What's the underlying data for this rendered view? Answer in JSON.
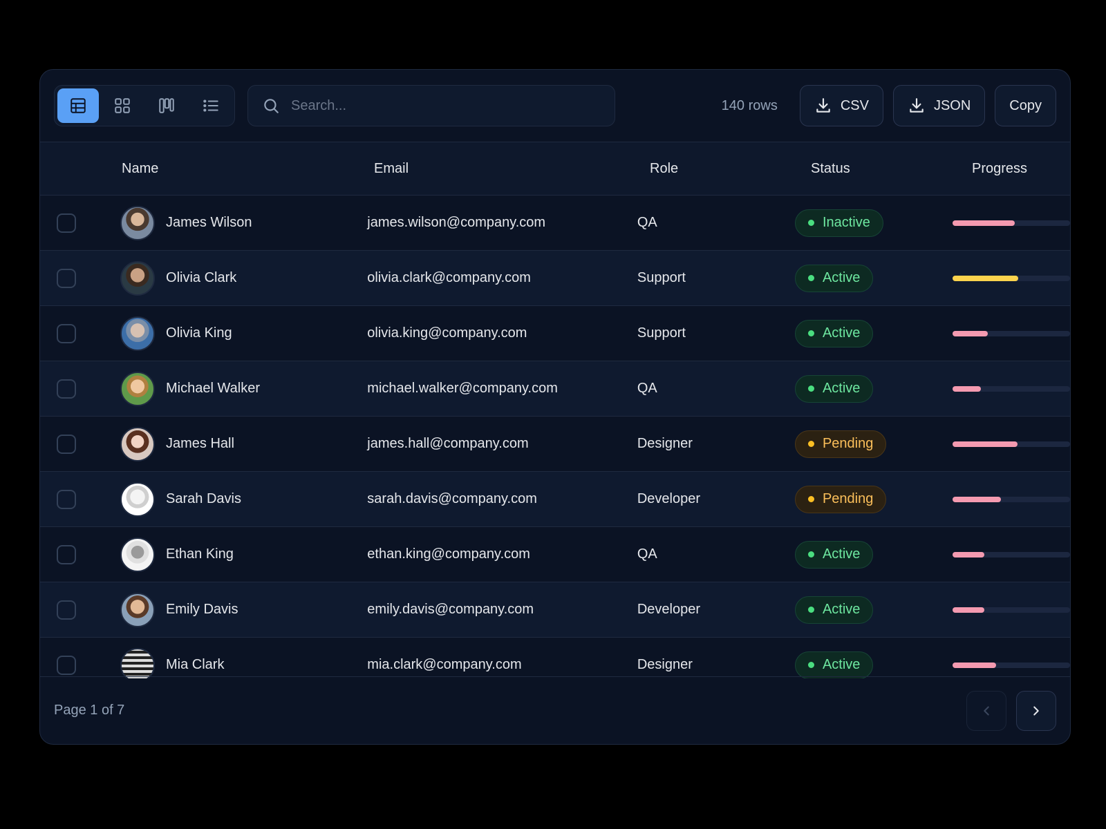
{
  "toolbar": {
    "views": [
      {
        "name": "table-view",
        "icon": "table-icon",
        "active": true
      },
      {
        "name": "grid-view",
        "icon": "grid-icon",
        "active": false
      },
      {
        "name": "board-view",
        "icon": "columns-icon",
        "active": false
      },
      {
        "name": "list-view",
        "icon": "list-icon",
        "active": false
      }
    ],
    "search_placeholder": "Search...",
    "row_count": "140 rows",
    "csv_label": "CSV",
    "json_label": "JSON",
    "copy_label": "Copy"
  },
  "table": {
    "columns": [
      "Name",
      "Email",
      "Role",
      "Status",
      "Progress"
    ],
    "rows": [
      {
        "name": "James Wilson",
        "email": "james.wilson@company.com",
        "role": "QA",
        "status": "Inactive",
        "status_tone": "green",
        "progress": 0.53,
        "progress_color": "#f49ab0"
      },
      {
        "name": "Olivia Clark",
        "email": "olivia.clark@company.com",
        "role": "Support",
        "status": "Active",
        "status_tone": "green",
        "progress": 0.56,
        "progress_color": "#fcd34d"
      },
      {
        "name": "Olivia King",
        "email": "olivia.king@company.com",
        "role": "Support",
        "status": "Active",
        "status_tone": "green",
        "progress": 0.3,
        "progress_color": "#f49ab0"
      },
      {
        "name": "Michael Walker",
        "email": "michael.walker@company.com",
        "role": "QA",
        "status": "Active",
        "status_tone": "green",
        "progress": 0.24,
        "progress_color": "#f49ab0"
      },
      {
        "name": "James Hall",
        "email": "james.hall@company.com",
        "role": "Designer",
        "status": "Pending",
        "status_tone": "amber",
        "progress": 0.55,
        "progress_color": "#f49ab0"
      },
      {
        "name": "Sarah Davis",
        "email": "sarah.davis@company.com",
        "role": "Developer",
        "status": "Pending",
        "status_tone": "amber",
        "progress": 0.41,
        "progress_color": "#f49ab0"
      },
      {
        "name": "Ethan King",
        "email": "ethan.king@company.com",
        "role": "QA",
        "status": "Active",
        "status_tone": "green",
        "progress": 0.27,
        "progress_color": "#f49ab0"
      },
      {
        "name": "Emily Davis",
        "email": "emily.davis@company.com",
        "role": "Developer",
        "status": "Active",
        "status_tone": "green",
        "progress": 0.27,
        "progress_color": "#f49ab0"
      },
      {
        "name": "Mia Clark",
        "email": "mia.clark@company.com",
        "role": "Designer",
        "status": "Active",
        "status_tone": "green",
        "progress": 0.37,
        "progress_color": "#f49ab0"
      }
    ]
  },
  "footer": {
    "page_info": "Page 1 of 7"
  },
  "colors": {
    "accent": "#5aa0f5",
    "active_green": "#4ade80",
    "pending_amber": "#fbbf24",
    "progress_pink": "#f49ab0",
    "progress_yellow": "#fcd34d"
  }
}
